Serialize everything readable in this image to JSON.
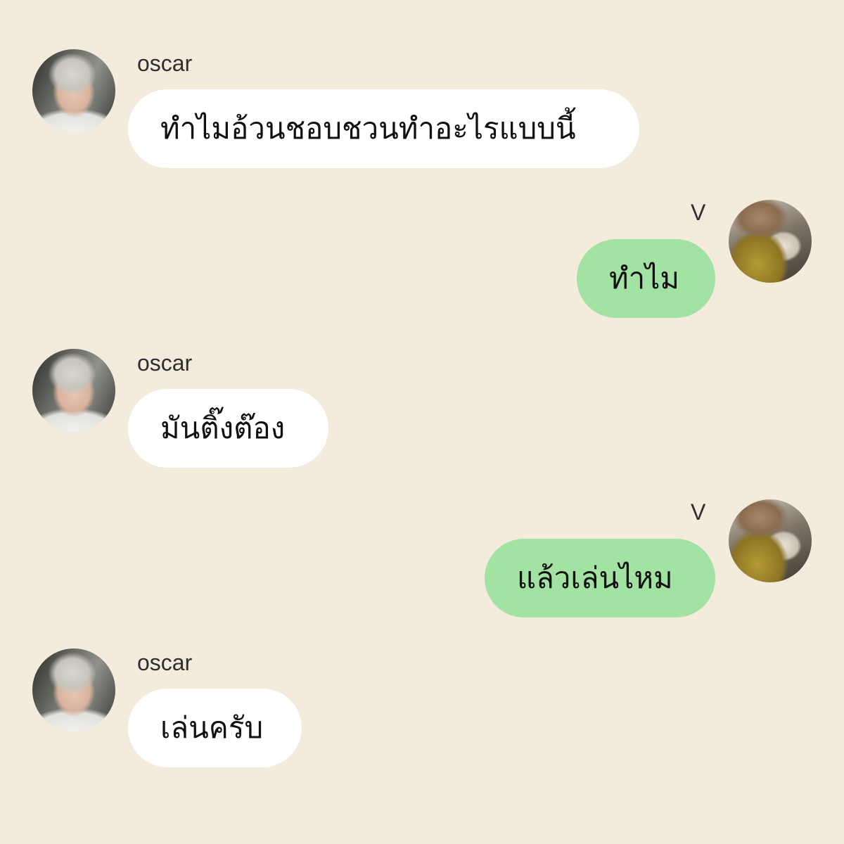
{
  "chat": {
    "colors": {
      "background": "#f3ebdc",
      "incoming_bubble": "#ffffff",
      "outgoing_bubble": "#a2e2a2"
    },
    "messages": [
      {
        "sender": "oscar",
        "direction": "incoming",
        "text": "ทำไมอ้วนชอบชวนทำอะไรแบบนี้"
      },
      {
        "sender": "V",
        "direction": "outgoing",
        "text": "ทำไม"
      },
      {
        "sender": "oscar",
        "direction": "incoming",
        "text": "มันติ๊งต๊อง"
      },
      {
        "sender": "V",
        "direction": "outgoing",
        "text": "แล้วเล่นไหม"
      },
      {
        "sender": "oscar",
        "direction": "incoming",
        "text": "เล่นครับ"
      }
    ]
  }
}
